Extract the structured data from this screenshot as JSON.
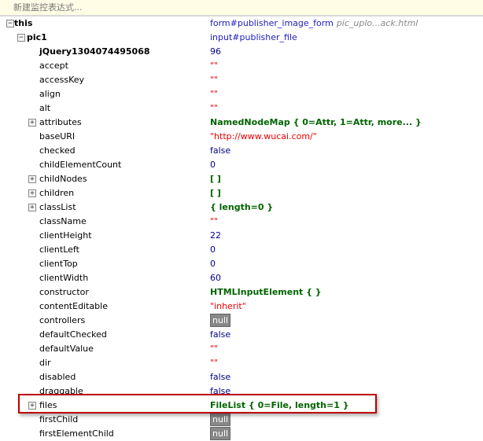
{
  "new_watch_placeholder": "新建监控表达式...",
  "rows": [
    {
      "name": "this",
      "level": 0,
      "toggle": "-",
      "bold": true,
      "value": "form#publisher_image_form",
      "type": "link",
      "extra": "pic_uplo...ack.html"
    },
    {
      "name": "pic1",
      "level": 1,
      "toggle": "-",
      "bold": true,
      "value": "input#publisher_file",
      "type": "link"
    },
    {
      "name": "jQuery1304074495068",
      "level": 2,
      "bold": true,
      "value": "96",
      "type": "num"
    },
    {
      "name": "accept",
      "level": 2,
      "value": "\"\"",
      "type": "str"
    },
    {
      "name": "accessKey",
      "level": 2,
      "value": "\"\"",
      "type": "str"
    },
    {
      "name": "align",
      "level": 2,
      "value": "\"\"",
      "type": "str"
    },
    {
      "name": "alt",
      "level": 2,
      "value": "\"\"",
      "type": "str"
    },
    {
      "name": "attributes",
      "level": 2,
      "toggle": "+",
      "value": "NamedNodeMap {  0=Attr,  1=Attr,  more... }",
      "type": "obj"
    },
    {
      "name": "baseURI",
      "level": 2,
      "value": "\"http://www.wucai.com/\"",
      "type": "str"
    },
    {
      "name": "checked",
      "level": 2,
      "value": "false",
      "type": "bool"
    },
    {
      "name": "childElementCount",
      "level": 2,
      "value": "0",
      "type": "num"
    },
    {
      "name": "childNodes",
      "level": 2,
      "toggle": "+",
      "value": "[  ]",
      "type": "obj"
    },
    {
      "name": "children",
      "level": 2,
      "toggle": "+",
      "value": "[  ]",
      "type": "obj"
    },
    {
      "name": "classList",
      "level": 2,
      "toggle": "+",
      "value": " {  length=0 }",
      "type": "obj"
    },
    {
      "name": "className",
      "level": 2,
      "value": "\"\"",
      "type": "str"
    },
    {
      "name": "clientHeight",
      "level": 2,
      "value": "22",
      "type": "num"
    },
    {
      "name": "clientLeft",
      "level": 2,
      "value": "0",
      "type": "num"
    },
    {
      "name": "clientTop",
      "level": 2,
      "value": "0",
      "type": "num"
    },
    {
      "name": "clientWidth",
      "level": 2,
      "value": "60",
      "type": "num"
    },
    {
      "name": "constructor",
      "level": 2,
      "value": "HTMLInputElement {  }",
      "type": "obj"
    },
    {
      "name": "contentEditable",
      "level": 2,
      "value": "\"inherit\"",
      "type": "str"
    },
    {
      "name": "controllers",
      "level": 2,
      "value": "null",
      "type": "null"
    },
    {
      "name": "defaultChecked",
      "level": 2,
      "value": "false",
      "type": "bool"
    },
    {
      "name": "defaultValue",
      "level": 2,
      "value": "\"\"",
      "type": "str"
    },
    {
      "name": "dir",
      "level": 2,
      "value": "\"\"",
      "type": "str"
    },
    {
      "name": "disabled",
      "level": 2,
      "value": "false",
      "type": "bool"
    },
    {
      "name": "draggable",
      "level": 2,
      "value": "false",
      "type": "bool"
    },
    {
      "name": "files",
      "level": 2,
      "toggle": "+",
      "value": "FileList {  0=File,  length=1 }",
      "type": "obj"
    },
    {
      "name": "firstChild",
      "level": 2,
      "value": "null",
      "type": "null"
    },
    {
      "name": "firstElementChild",
      "level": 2,
      "value": "null",
      "type": "null"
    }
  ]
}
